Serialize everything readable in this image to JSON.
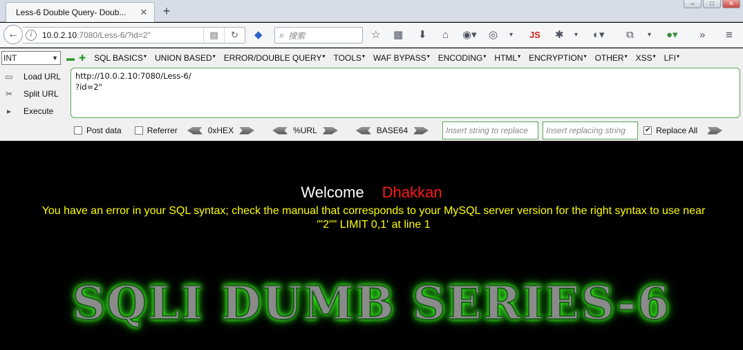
{
  "tab": {
    "title": "Less-6 Double Query- Doub...",
    "close": "✕",
    "new": "+"
  },
  "window": {
    "minimize": "–",
    "maximize": "□",
    "close": "✕"
  },
  "nav": {
    "url_host": "10.0.2.10",
    "url_rest": ":7080/Less-6/?id=2\"",
    "search_placeholder": "搜索",
    "js_label": "JS"
  },
  "hackbar": {
    "type_select": "INT",
    "menu": [
      "SQL BASICS",
      "UNION BASED",
      "ERROR/DOUBLE QUERY",
      "TOOLS",
      "WAF BYPASS",
      "ENCODING",
      "HTML",
      "ENCRYPTION",
      "OTHER",
      "XSS",
      "LFI"
    ],
    "load_url": "Load URL",
    "split_url": "Split URL",
    "execute": "Execute",
    "url_line1": "http://10.0.2.10:7080/Less-6/",
    "url_line2": "?id=2\"",
    "post_data": "Post data",
    "referrer": "Referrer",
    "hex": "0xHEX",
    "urlenc": "%URL",
    "base64": "BASE64",
    "insert_replace_ph": "Insert string to replace",
    "insert_replacing_ph": "Insert replacing string",
    "replace_all": "Replace All",
    "replace_all_checked": true
  },
  "page": {
    "welcome": "Welcome",
    "name": "Dhakkan",
    "error_line1": "You have an error in your SQL syntax; check the manual that corresponds to your MySQL server version for the right syntax to use near",
    "error_line2": "'\"2\"\" LIMIT 0,1' at line 1",
    "banner": "SQLI DUMB SERIES-6"
  },
  "colors": {
    "welcome_name": "#ff1a1a",
    "error_text": "#ffff00",
    "banner_glow": "#39ff14",
    "hackbar_border": "#59a659"
  }
}
